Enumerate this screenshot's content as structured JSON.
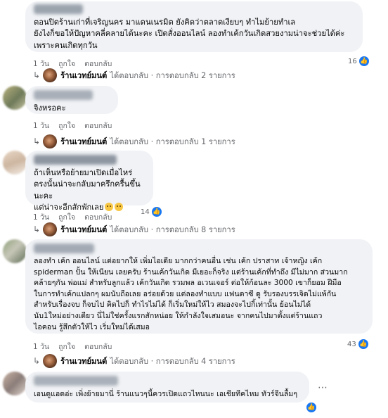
{
  "colors": {
    "bubble": "#f0f2f5",
    "like": "#1877f2",
    "muted": "#65676b"
  },
  "actions": {
    "like": "ถูกใจ",
    "reply": "ตอบกลับ"
  },
  "page_name": "ร้านเวทย์มนต์",
  "comments": [
    {
      "text": "ตอนปิดร้านเก่าที่เจริญนคร มาแดนเนรมิต ยังคิดว่าตลาดเงียบๆ ทำไมย้ายทำเล\nยังไงก็ขอให้ปัญหาคลี่คลายได้นะคะ เปิดสั่งออนไลน์ ลองทำเค้กวันเกิดสวยงามน่าจะช่วยได้ค่ะ\nเพราะคนเกิดทุกวัน",
      "time": "1 วัน",
      "reaction_count": "16",
      "reply_text": "ได้ตอบกลับ · การตอบกลับ 2 รายการ"
    },
    {
      "text": "จิงหรอคะ",
      "time": "1 วัน",
      "reaction_count": "",
      "reply_text": "ได้ตอบกลับ · การตอบกลับ 1 รายการ"
    },
    {
      "text": "ถ้าเห็นหรือย้ายมาเปิดเมื่อไหร่\nตรงนั้นน่าจะกลับมาครึกครื้นขึ้นนะคะ\nแต่น่าจะอีกสักพักเลย",
      "time": "1 วัน",
      "reaction_count": "14",
      "reply_text": "ได้ตอบกลับ · การตอบกลับ 8 รายการ"
    },
    {
      "text": "ลองทำ เค้ก ออนไลน์ แต่อยากให้ เพิ่มไอเดีย มากกว่าคนอื่น เช่น เค้ก ปราสาท เจ้าหญิง เค้ก\nspiderman ปั้น ให้เนียน เลยครับ ร้านเค้กวันเกิด มีเยอะก็จริง แต่ร้านเค้กที่ทำถึง มีไม่มาก ส่วนมาก\nคล้ายๆกัน พ่อแม่ สำหรับลูกแล้ว เค้กวันเกิด รวมพล อเวนเจอร์ ต่อให้ก้อนละ 3000 เขาก็ยอม ฝีมือ\nในการทำเค้กแปลกๆ ผมนับถือเลย อร่อยด้วย แต่ลองทำแบบ แฟนตาซี ดู รับรองบรรเจิดไม่แพ้กัน\nสำหรับเรื่องจบ ก็จบไป คิดไปก็ ทำไรไม่ได้ ก็เริ่มใหม่ให้ไว สมองจะไปกิ้เท่านั้น ย้อนไม่ได้\nนับ1ใหม่อย่างเดียว นี่ไม่ใช่ครั้งแรกสักหน่อย ให้กำลังใจเสมอนะ จากคนไปมาตั้งแต่ร้านแถว\nไอคอน รู้สึกตัวให้ไว เริ่มใหม่ได้เสมอ",
      "time": "1 วัน",
      "reaction_count": "43",
      "reply_text": "ได้ตอบกลับ · การตอบกลับ 4 รายการ"
    },
    {
      "text": "เอนดูแอดอ่ะ เพิ่งย้ายมานี่ ร้านแนวๆนี้ควรเปิดแถวไหนนะ เอเชียทีคไหม ทัวร์จีนลื้มๆ",
      "time": "",
      "reaction_count": "",
      "reply_text": ""
    }
  ]
}
